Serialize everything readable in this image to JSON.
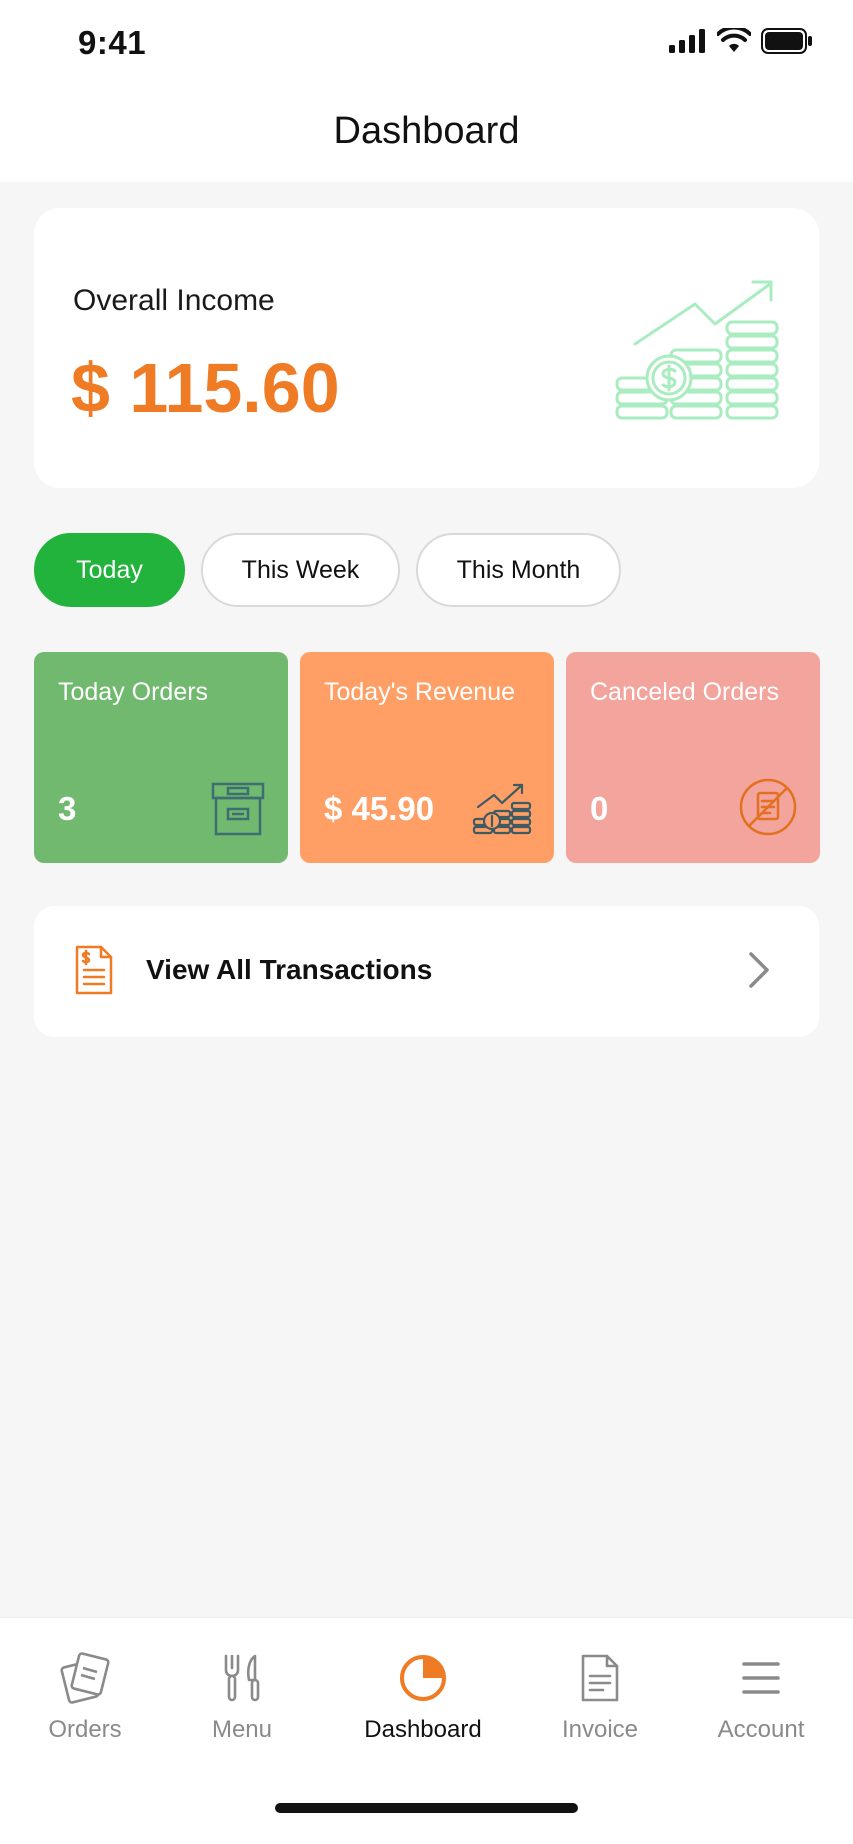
{
  "status": {
    "time": "9:41"
  },
  "header": {
    "title": "Dashboard"
  },
  "income": {
    "label": "Overall Income",
    "value": "$ 115.60"
  },
  "filters": [
    {
      "label": "Today",
      "active": true
    },
    {
      "label": "This Week",
      "active": false
    },
    {
      "label": "This Month",
      "active": false
    }
  ],
  "stats": [
    {
      "title": "Today Orders",
      "value": "3",
      "icon": "archive-box-icon"
    },
    {
      "title": "Today's Revenue",
      "value": "$ 45.90",
      "icon": "coins-growth-icon"
    },
    {
      "title": "Canceled Orders",
      "value": "0",
      "icon": "canceled-receipt-icon"
    }
  ],
  "transactions": {
    "label": "View All Transactions"
  },
  "tabs": [
    {
      "label": "Orders",
      "icon": "orders-icon",
      "active": false
    },
    {
      "label": "Menu",
      "icon": "fork-knife-icon",
      "active": false
    },
    {
      "label": "Dashboard",
      "icon": "pie-chart-icon",
      "active": true
    },
    {
      "label": "Invoice",
      "icon": "invoice-icon",
      "active": false
    },
    {
      "label": "Account",
      "icon": "menu-lines-icon",
      "active": false
    }
  ],
  "colors": {
    "accent_orange": "#f07b25",
    "active_green": "#22b33c",
    "card_green": "#70b96f",
    "card_orange": "#ff9f66",
    "card_red": "#f2a49d"
  }
}
